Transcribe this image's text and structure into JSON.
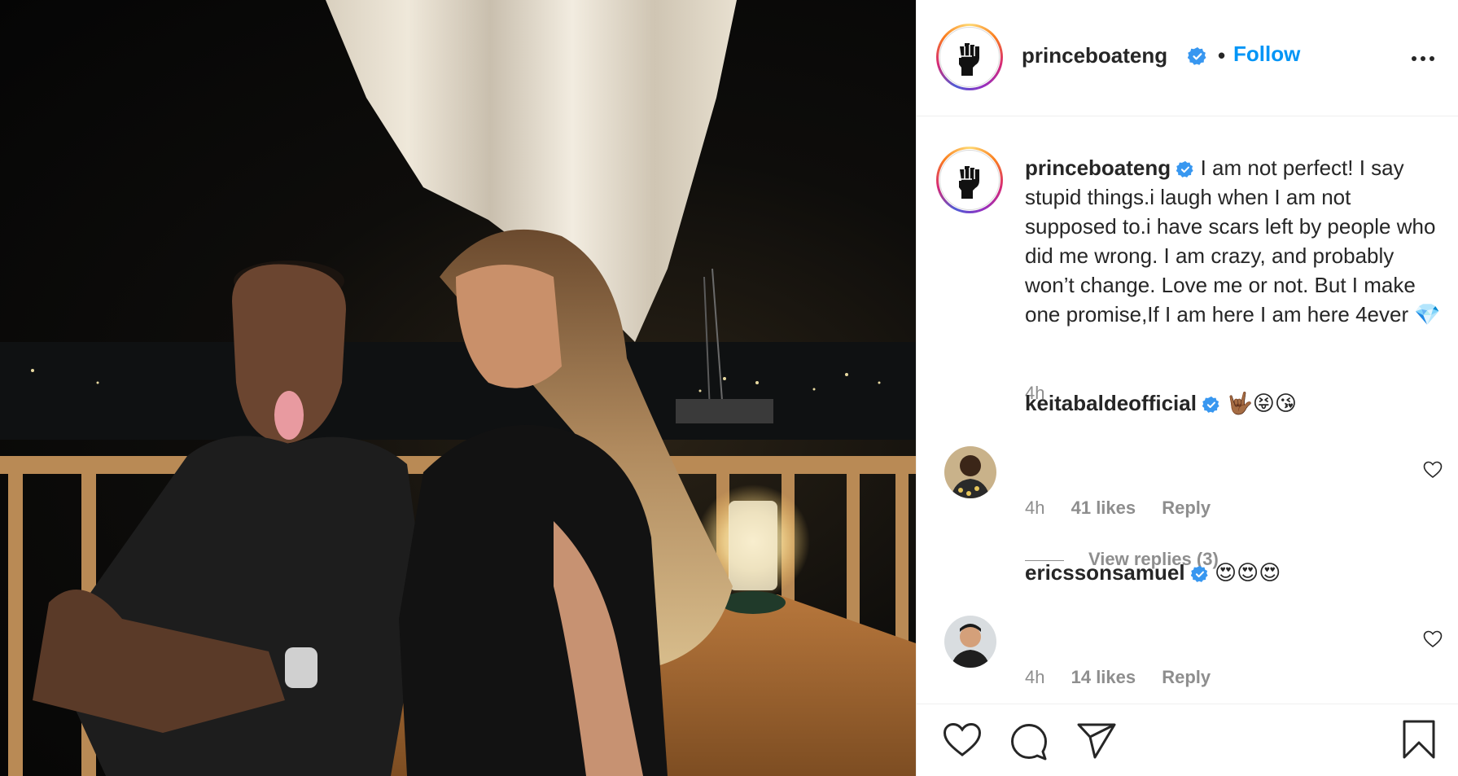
{
  "post": {
    "username": "princeboateng",
    "dot": "•",
    "follow_label": "Follow",
    "more_icon": "more-horizontal-icon"
  },
  "caption": {
    "username": "princeboateng",
    "text": "I am not perfect! I say stupid things.i laugh when I am not supposed to.i have scars left by people who did me wrong. I am crazy, and probably won’t change. Love me or not. But I make one promise,If I am here I am here 4ever 💎",
    "time": "4h"
  },
  "comments": [
    {
      "username": "keitabaldeofficial",
      "text": "🤟🏾😝😘",
      "time": "4h",
      "likes": "41 likes",
      "reply_label": "Reply",
      "view_replies": "View replies (3)"
    },
    {
      "username": "ericssonsamuel",
      "text": "😍😍😍",
      "time": "4h",
      "likes": "14 likes",
      "reply_label": "Reply"
    }
  ],
  "colors": {
    "link": "#0095f6",
    "verified": "#3897f0",
    "muted": "#8e8e8e",
    "text": "#262626"
  }
}
